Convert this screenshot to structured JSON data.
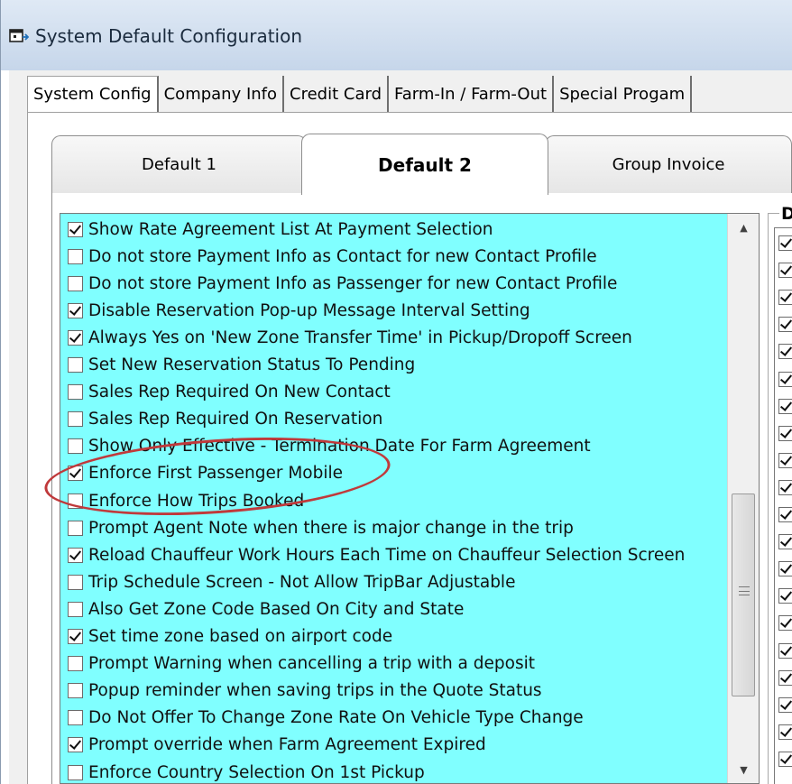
{
  "window": {
    "title": "System Default Configuration",
    "icon": "app-window-icon"
  },
  "outer_tabs": [
    {
      "label": "System Config",
      "active": true
    },
    {
      "label": "Company Info",
      "active": false
    },
    {
      "label": "Credit Card",
      "active": false
    },
    {
      "label": "Farm-In / Farm-Out",
      "active": false
    },
    {
      "label": "Special Progam",
      "active": false
    }
  ],
  "inner_tabs": [
    {
      "label": "Default 1",
      "active": false
    },
    {
      "label": "Default 2",
      "active": true
    },
    {
      "label": "Group Invoice",
      "active": false
    }
  ],
  "options": [
    {
      "label": "Show Rate Agreement List At Payment Selection",
      "checked": true
    },
    {
      "label": "Do not store Payment Info as Contact for new Contact Profile",
      "checked": false
    },
    {
      "label": "Do not store Payment Info as Passenger for new Contact Profile",
      "checked": false
    },
    {
      "label": "Disable Reservation Pop-up Message Interval Setting",
      "checked": true
    },
    {
      "label": "Always Yes on 'New Zone Transfer Time' in Pickup/Dropoff Screen",
      "checked": true
    },
    {
      "label": "Set New Reservation Status To Pending",
      "checked": false
    },
    {
      "label": "Sales Rep Required On New Contact",
      "checked": false
    },
    {
      "label": "Sales Rep Required On Reservation",
      "checked": false
    },
    {
      "label": "Show Only Effective - Termination Date For Farm Agreement",
      "checked": false
    },
    {
      "label": "Enforce First Passenger Mobile",
      "checked": true
    },
    {
      "label": "Enforce How Trips Booked",
      "checked": false
    },
    {
      "label": "Prompt Agent Note when there is major change in the trip",
      "checked": false
    },
    {
      "label": "Reload Chauffeur Work Hours Each Time on Chauffeur Selection Screen",
      "checked": true
    },
    {
      "label": "Trip Schedule Screen - Not Allow TripBar Adjustable",
      "checked": false
    },
    {
      "label": "Also Get Zone Code Based On City and State",
      "checked": false
    },
    {
      "label": "Set time zone based on airport code",
      "checked": true
    },
    {
      "label": "Prompt Warning when cancelling a trip with a deposit",
      "checked": false
    },
    {
      "label": "Popup reminder when saving trips in the Quote Status",
      "checked": false
    },
    {
      "label": "Do Not Offer To Change Zone Rate On Vehicle Type Change",
      "checked": false
    },
    {
      "label": "Prompt override when Farm Agreement Expired",
      "checked": true
    },
    {
      "label": "Enforce Country Selection On 1st Pickup",
      "checked": false
    }
  ],
  "scrollbar": {
    "up_glyph": "▲",
    "down_glyph": "▼",
    "position_fraction": 0.5
  },
  "right_group": {
    "title_fragment": "D",
    "visible_checked_count": 20
  },
  "annotation": {
    "highlighted_option": "Enforce First Passenger Mobile",
    "color": "#c0393b"
  },
  "colors": {
    "list_background": "#80ffff",
    "title_bar": "#dfe9f5"
  }
}
